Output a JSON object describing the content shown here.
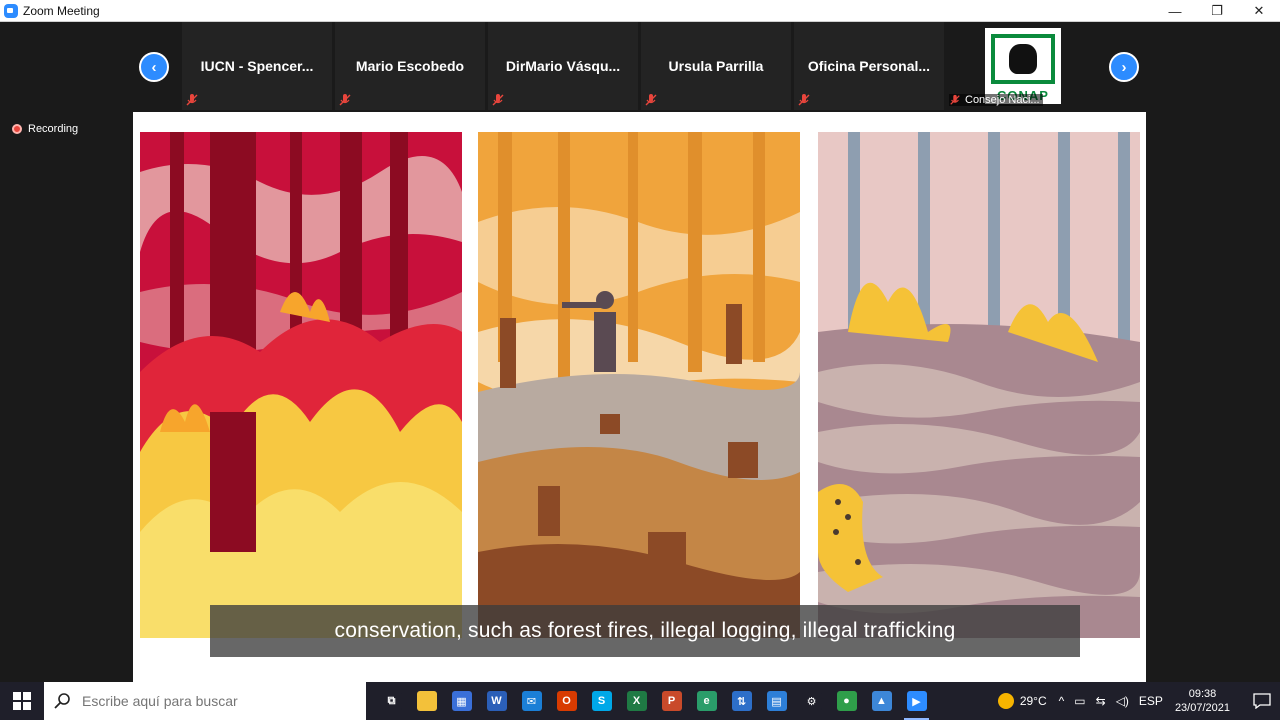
{
  "window": {
    "title": "Zoom Meeting",
    "minimize": "—",
    "maximize": "❐",
    "close": "✕"
  },
  "participants": [
    {
      "name": "IUCN  - Spencer..."
    },
    {
      "name": "Mario Escobedo"
    },
    {
      "name": "DirMario  Vásqu..."
    },
    {
      "name": "Ursula Parrilla"
    },
    {
      "name": "Oficina  Personal..."
    }
  ],
  "logo_tile": {
    "logo_text": "CONAP",
    "caption": "Consejo Naci..."
  },
  "nav": {
    "prev": "‹",
    "next": "›"
  },
  "recording": {
    "label": "Recording"
  },
  "shared_screen": {
    "subtitle": "conservation, such as forest fires, illegal logging, illegal trafficking"
  },
  "taskbar": {
    "search_placeholder": "Escribe aquí para buscar",
    "apps": [
      {
        "icon": "task-view-icon",
        "color": "#1f1f2a",
        "glyph": "⧉"
      },
      {
        "icon": "file-explorer-icon",
        "color": "#f3c13a",
        "glyph": ""
      },
      {
        "icon": "store-icon",
        "color": "#3a6fd8",
        "glyph": "▦"
      },
      {
        "icon": "word-icon",
        "color": "#2b5fb8",
        "glyph": "W"
      },
      {
        "icon": "mail-icon",
        "color": "#1b7fd6",
        "glyph": "✉"
      },
      {
        "icon": "office-icon",
        "color": "#d83b01",
        "glyph": "O"
      },
      {
        "icon": "skype-icon",
        "color": "#00a8e8",
        "glyph": "S"
      },
      {
        "icon": "excel-icon",
        "color": "#1f7a44",
        "glyph": "X"
      },
      {
        "icon": "powerpoint-icon",
        "color": "#c94a2a",
        "glyph": "P"
      },
      {
        "icon": "edge-icon",
        "color": "#2a9d6a",
        "glyph": "e"
      },
      {
        "icon": "network-app-icon",
        "color": "#2d6fc9",
        "glyph": "⇅"
      },
      {
        "icon": "calendar-icon",
        "color": "#2d7fd8",
        "glyph": "▤"
      },
      {
        "icon": "settings-icon",
        "color": "#1f1f2a",
        "glyph": "⚙"
      },
      {
        "icon": "chrome-icon",
        "color": "#2f9e4a",
        "glyph": "●"
      },
      {
        "icon": "photos-icon",
        "color": "#3d87d8",
        "glyph": "▲"
      },
      {
        "icon": "zoom-icon",
        "color": "#2d8cff",
        "glyph": "▶",
        "active": true
      }
    ],
    "weather": "29°C",
    "chevron": "^",
    "language": "ESP",
    "time": "09:38",
    "date": "23/07/2021"
  }
}
